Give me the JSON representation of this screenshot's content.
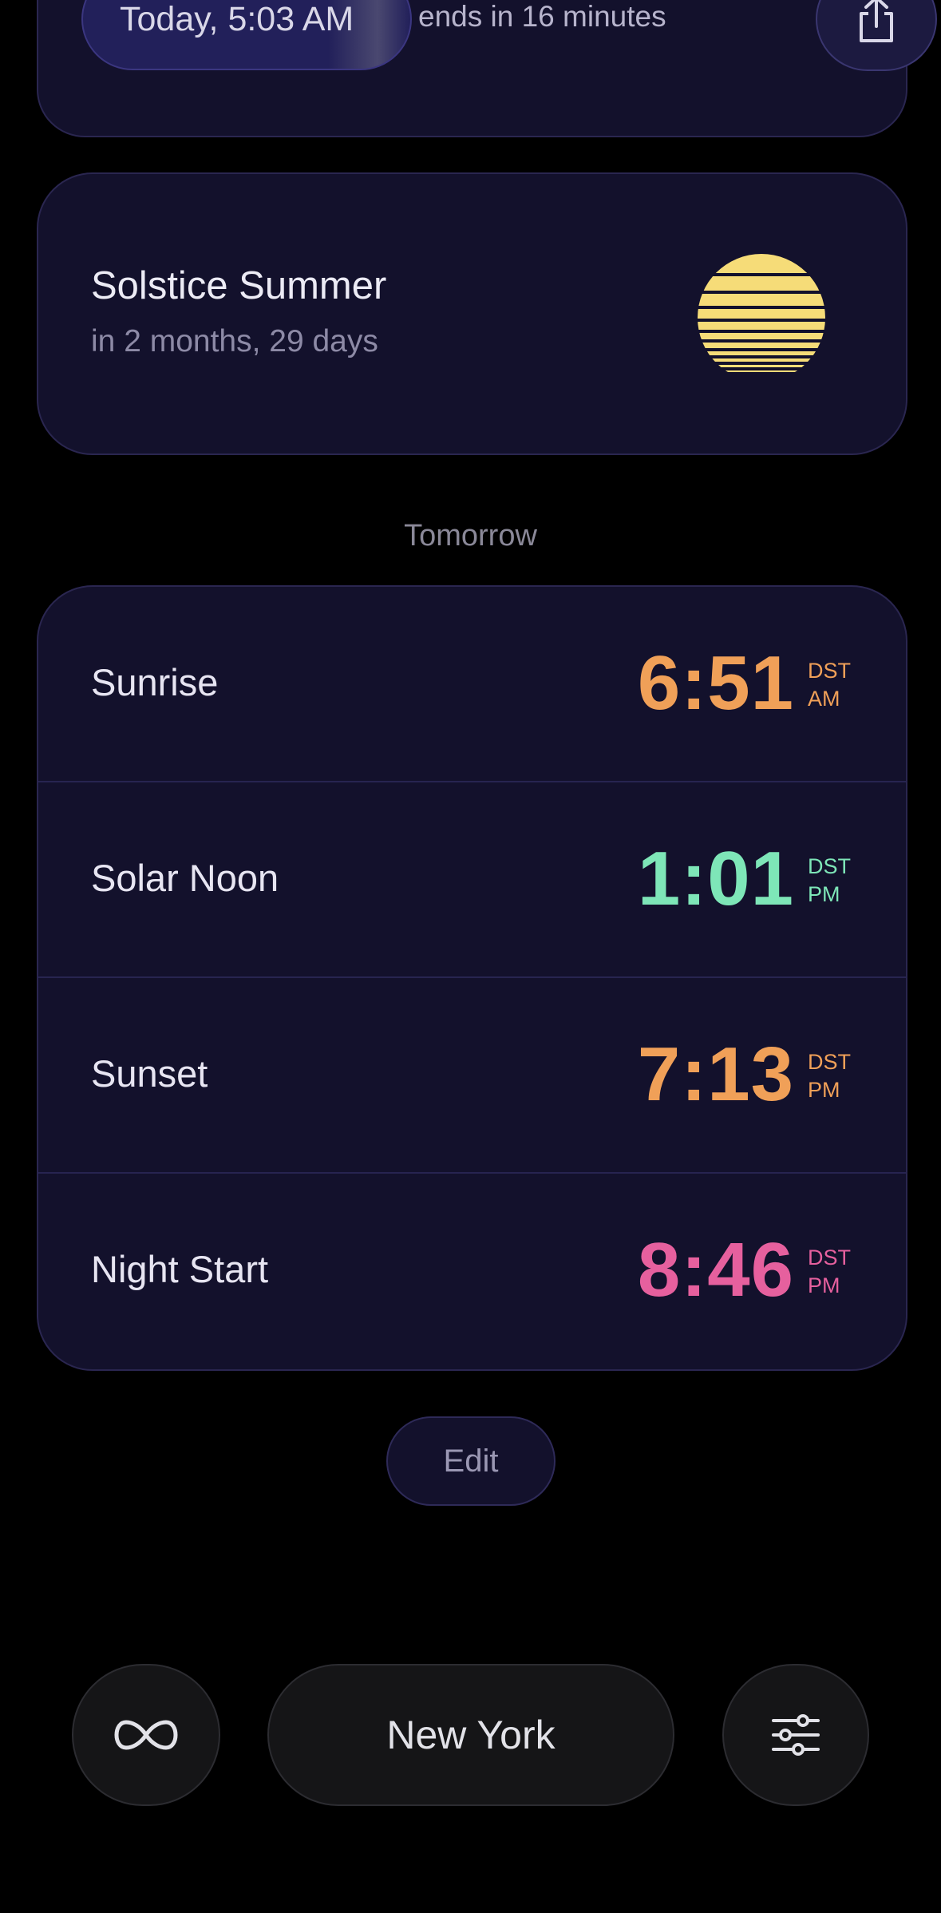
{
  "current": {
    "time_label": "Today, 5:03 AM",
    "ends_text": "ends in 16 minutes"
  },
  "event": {
    "title": "Solstice Summer",
    "countdown": "in 2 months, 29 days"
  },
  "section_label": "Tomorrow",
  "times": [
    {
      "label": "Sunrise",
      "time": "6:51",
      "zone": "DST",
      "ampm": "AM",
      "color": "#f0a058"
    },
    {
      "label": "Solar Noon",
      "time": "1:01",
      "zone": "DST",
      "ampm": "PM",
      "color": "#7ee6b8"
    },
    {
      "label": "Sunset",
      "time": "7:13",
      "zone": "DST",
      "ampm": "PM",
      "color": "#f0a058"
    },
    {
      "label": "Night Start",
      "time": "8:46",
      "zone": "DST",
      "ampm": "PM",
      "color": "#e6609e"
    }
  ],
  "edit_label": "Edit",
  "bottom_bar": {
    "city": "New York",
    "loop_icon": "infinity-icon",
    "settings_icon": "sliders-icon"
  },
  "colors": {
    "background": "#000000",
    "card": "#13112c",
    "sun": "#f6dc78"
  }
}
